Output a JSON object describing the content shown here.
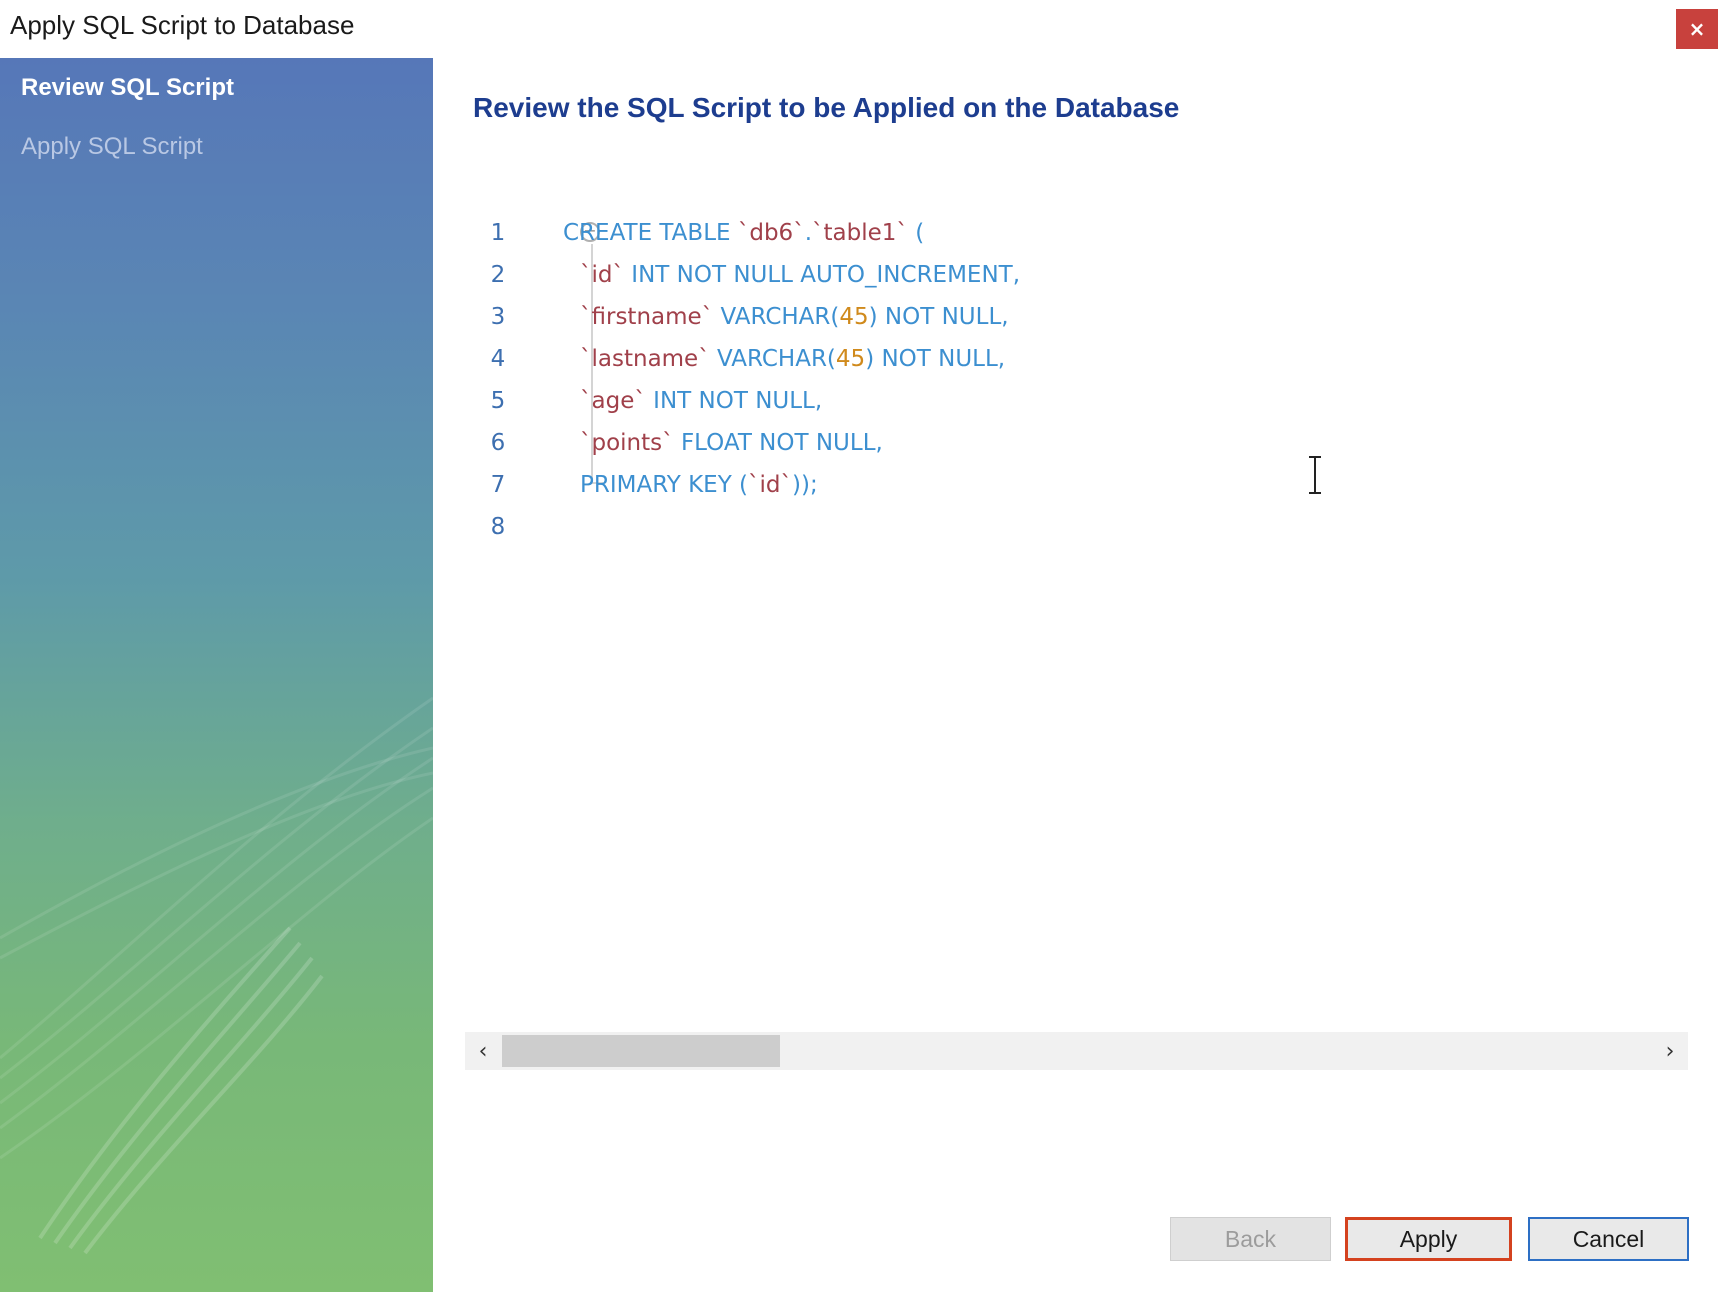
{
  "window": {
    "title": "Apply SQL Script to Database",
    "close_label": "×"
  },
  "sidebar": {
    "steps": [
      {
        "label": "Review SQL Script",
        "active": true
      },
      {
        "label": "Apply SQL Script",
        "active": false
      }
    ]
  },
  "main": {
    "heading": "Review the SQL Script to be Applied on the Database"
  },
  "editor": {
    "lines": [
      {
        "number": "1",
        "tokens": [
          {
            "t": "CREATE TABLE ",
            "c": "kw"
          },
          {
            "t": "`db6`",
            "c": "ident"
          },
          {
            "t": ".",
            "c": "punct"
          },
          {
            "t": "`table1`",
            "c": "ident"
          },
          {
            "t": " (",
            "c": "punct"
          }
        ]
      },
      {
        "number": "2",
        "tokens": [
          {
            "t": "`id`",
            "c": "ident"
          },
          {
            "t": " INT NOT NULL AUTO_INCREMENT,",
            "c": "kw"
          }
        ]
      },
      {
        "number": "3",
        "tokens": [
          {
            "t": "`firstname`",
            "c": "ident"
          },
          {
            "t": " VARCHAR(",
            "c": "kw"
          },
          {
            "t": "45",
            "c": "num"
          },
          {
            "t": ") NOT NULL,",
            "c": "kw"
          }
        ]
      },
      {
        "number": "4",
        "tokens": [
          {
            "t": "`lastname`",
            "c": "ident"
          },
          {
            "t": " VARCHAR(",
            "c": "kw"
          },
          {
            "t": "45",
            "c": "num"
          },
          {
            "t": ") NOT NULL,",
            "c": "kw"
          }
        ]
      },
      {
        "number": "5",
        "tokens": [
          {
            "t": "`age`",
            "c": "ident"
          },
          {
            "t": " INT NOT NULL,",
            "c": "kw"
          }
        ]
      },
      {
        "number": "6",
        "tokens": [
          {
            "t": "`points`",
            "c": "ident"
          },
          {
            "t": " FLOAT NOT NULL,",
            "c": "kw"
          }
        ]
      },
      {
        "number": "7",
        "tokens": [
          {
            "t": "PRIMARY KEY (",
            "c": "kw"
          },
          {
            "t": "`id`",
            "c": "ident"
          },
          {
            "t": "));",
            "c": "kw"
          }
        ]
      },
      {
        "number": "8",
        "tokens": []
      }
    ]
  },
  "scrollbar": {
    "left_arrow": "‹",
    "right_arrow": "›"
  },
  "buttons": {
    "back": "Back",
    "apply": "Apply",
    "cancel": "Cancel"
  },
  "colors": {
    "heading": "#1d3d8f",
    "keyword": "#3c8fd0",
    "identifier": "#a0404a",
    "number": "#d08a1c",
    "line_number": "#3d6fb0",
    "close_button": "#c8413d",
    "apply_highlight": "#d4421f",
    "cancel_border": "#2d6fc4"
  }
}
